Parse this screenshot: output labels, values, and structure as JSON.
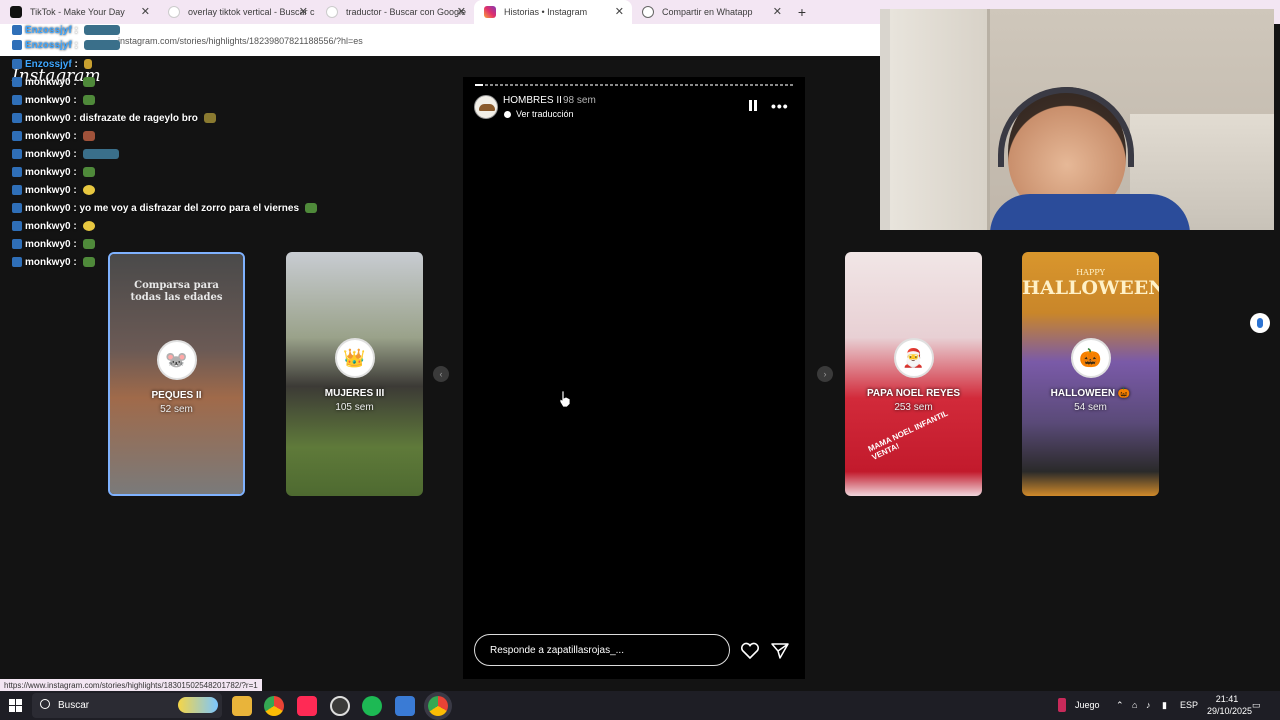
{
  "browser": {
    "tabs": [
      {
        "label": "TikTok - Make Your Day",
        "active": false,
        "icon": "tiktok-icon"
      },
      {
        "label": "overlay tiktok vertical - Buscar c",
        "active": false,
        "icon": "google-icon"
      },
      {
        "label": "traductor - Buscar con Google",
        "active": false,
        "icon": "google-icon"
      },
      {
        "label": "Historias • Instagram",
        "active": true,
        "icon": "instagram-icon"
      },
      {
        "label": "Compartir en Whatapp",
        "active": false,
        "icon": "globe-icon"
      }
    ],
    "new_tab": "+",
    "close": "✕",
    "url": "instagram.com/stories/highlights/18239807821188556/?hl=es"
  },
  "logo": "Instagram",
  "chat": [
    {
      "user": "Enzossjyf",
      "text": ":",
      "alt": true
    },
    {
      "user": "Enzossjyf",
      "text": ":",
      "alt": true
    },
    {
      "user": "Enzossjyf",
      "text": ":",
      "alt": true
    },
    {
      "user": "monkwy0",
      "text": ":",
      "alt": false
    },
    {
      "user": "monkwy0",
      "text": ":",
      "alt": false
    },
    {
      "user": "monkwy0",
      "text": ": disfrazate de rageylo bro",
      "alt": false
    },
    {
      "user": "monkwy0",
      "text": ":",
      "alt": false
    },
    {
      "user": "monkwy0",
      "text": ":",
      "alt": false
    },
    {
      "user": "monkwy0",
      "text": ":",
      "alt": false
    },
    {
      "user": "monkwy0",
      "text": ":",
      "alt": false
    },
    {
      "user": "monkwy0",
      "text": ": yo me voy a disfrazar del zorro para el viernes",
      "alt": false
    },
    {
      "user": "monkwy0",
      "text": ":",
      "alt": false
    },
    {
      "user": "monkwy0",
      "text": ":",
      "alt": false
    },
    {
      "user": "monkwy0",
      "text": ":",
      "alt": false
    }
  ],
  "story": {
    "title": "HOMBRES II",
    "time": "98 sem",
    "translate": "Ver traducción",
    "reply_placeholder": "Responde a zapatillasrojas_...",
    "more": "•••"
  },
  "highlights": [
    {
      "name": "PEQUES II",
      "time": "52 sem",
      "caption": "Comparsa para todas las edades",
      "emoji": "🐭",
      "selected": true
    },
    {
      "name": "MUJERES III",
      "time": "105 sem",
      "caption": "",
      "emoji": "👑",
      "selected": false
    },
    {
      "name": "PAPA NOEL REYES",
      "time": "253 sem",
      "caption": "",
      "stamp": "MAMA NOEL INFANTIL VENTA!",
      "emoji": "🎅",
      "selected": false
    },
    {
      "name": "HALLOWEEN 🎃",
      "time": "54 sem",
      "caption": "",
      "banner_small": "HAPPY",
      "banner_big": "HALLOWEEN",
      "emoji": "🎃",
      "selected": false
    }
  ],
  "nav": {
    "prev": "‹",
    "next": "›"
  },
  "status_url": "https://www.instagram.com/stories/highlights/18301502548201782/?r=1",
  "taskbar": {
    "search": "Buscar",
    "game_label": "Juego",
    "lang": "ESP",
    "time": "21:41",
    "date": "29/10/2025"
  },
  "colors": {
    "tab_bar": "#f3e6f3",
    "page_bg": "#131313",
    "accent_blue": "#7fb2ff",
    "username_alt": "#3fa7ff"
  }
}
